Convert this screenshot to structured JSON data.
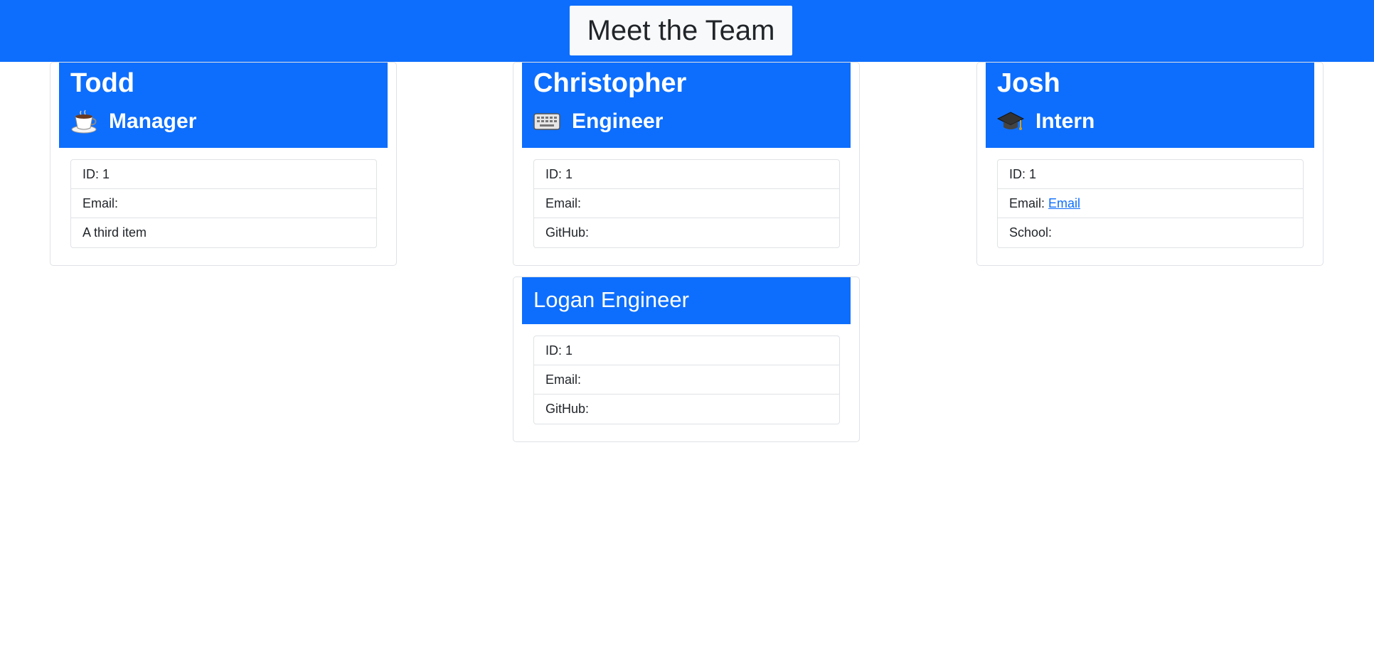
{
  "header": {
    "title": "Meet the Team"
  },
  "cards": [
    {
      "name": "Todd",
      "role": "Manager",
      "role_icon": "coffee-cup-icon",
      "items": [
        "ID: 1",
        "Email:",
        "A third item"
      ]
    },
    {
      "name": "Christopher",
      "role": "Engineer",
      "role_icon": "keyboard-icon",
      "items": [
        "ID: 1",
        "Email:",
        "GitHub:"
      ]
    },
    {
      "name": "Josh",
      "role": "Intern",
      "role_icon": "graduation-cap-icon",
      "items": [
        "ID: 1",
        "Email:",
        "School:"
      ],
      "email_link": "Email"
    },
    {
      "title": "Logan Engineer",
      "items": [
        "ID: 1",
        "Email:",
        "GitHub:"
      ]
    }
  ],
  "colors": {
    "accent": "#0d6efd",
    "header_title_bg": "#f8f9fa",
    "border": "#dfe2e5"
  }
}
